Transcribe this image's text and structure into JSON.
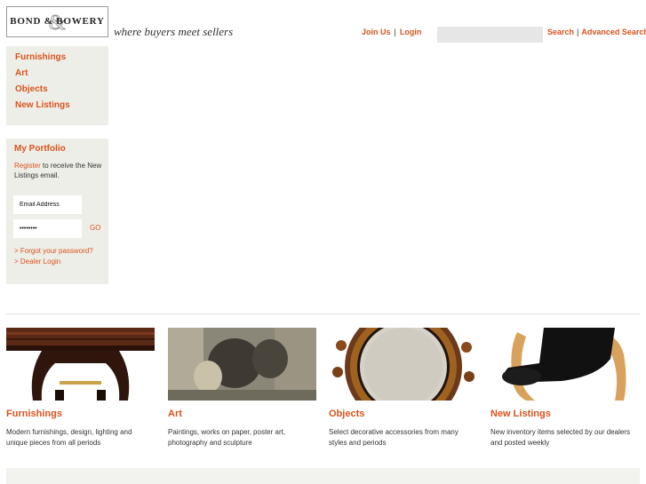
{
  "header": {
    "logo_text": "BOND & BOWERY",
    "tagline": "where buyers meet sellers",
    "join_label": "Join Us",
    "login_label": "Login",
    "search_placeholder": "",
    "search_label": "Search",
    "advanced_search_label": "Advanced Search"
  },
  "nav": {
    "items": [
      {
        "label": "Furnishings"
      },
      {
        "label": "Art"
      },
      {
        "label": "Objects"
      },
      {
        "label": "New Listings"
      }
    ]
  },
  "portfolio": {
    "title": "My Portfolio",
    "register_link": "Register",
    "register_text": " to receive the New Listings email.",
    "email_value": "Email Address",
    "password_value": "••••••••",
    "go_label": "GO",
    "forgot_label": "> Forgot your password?",
    "dealer_label": "> Dealer Login"
  },
  "tiles": [
    {
      "title": "Furnishings",
      "text": "Modern furnishings, design, lighting and unique pieces from all periods",
      "image_icon": "console-table-image"
    },
    {
      "title": "Art",
      "text": "Paintings, works on paper, poster art, photography and sculpture",
      "image_icon": "painting-image"
    },
    {
      "title": "Objects",
      "text": "Select decorative accessories from many styles and periods",
      "image_icon": "mirror-image"
    },
    {
      "title": "New Listings",
      "text": "New inventory items selected by our dealers and posted weekly",
      "image_icon": "lounge-chair-image"
    }
  ],
  "colors": {
    "accent": "#d9531e",
    "panel": "#eeeee8"
  }
}
